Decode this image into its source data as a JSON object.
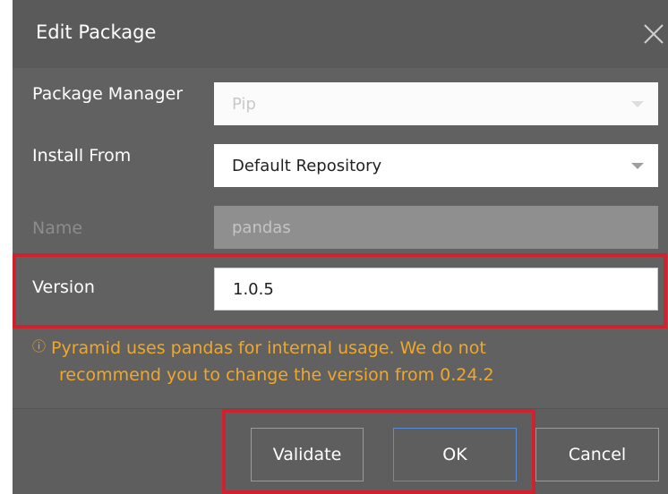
{
  "dialog": {
    "title": "Edit Package",
    "close_icon": "close-icon"
  },
  "form": {
    "package_manager": {
      "label": "Package Manager",
      "value": "Pip"
    },
    "install_from": {
      "label": "Install From",
      "value": "Default Repository"
    },
    "name": {
      "label": "Name",
      "value": "pandas"
    },
    "version": {
      "label": "Version",
      "value": "1.0.5"
    }
  },
  "warning": {
    "icon": "info-icon",
    "icon_glyph": "ⓘ",
    "line1": "Pyramid uses pandas for internal usage. We do not",
    "line2": "recommend you to change the version from 0.24.2"
  },
  "buttons": {
    "validate": "Validate",
    "ok": "OK",
    "cancel": "Cancel"
  },
  "colors": {
    "dialog_bg": "#616161",
    "warning_text": "#f0a72a",
    "highlight_border": "#d0212e",
    "ok_border": "#5a8fd8"
  }
}
